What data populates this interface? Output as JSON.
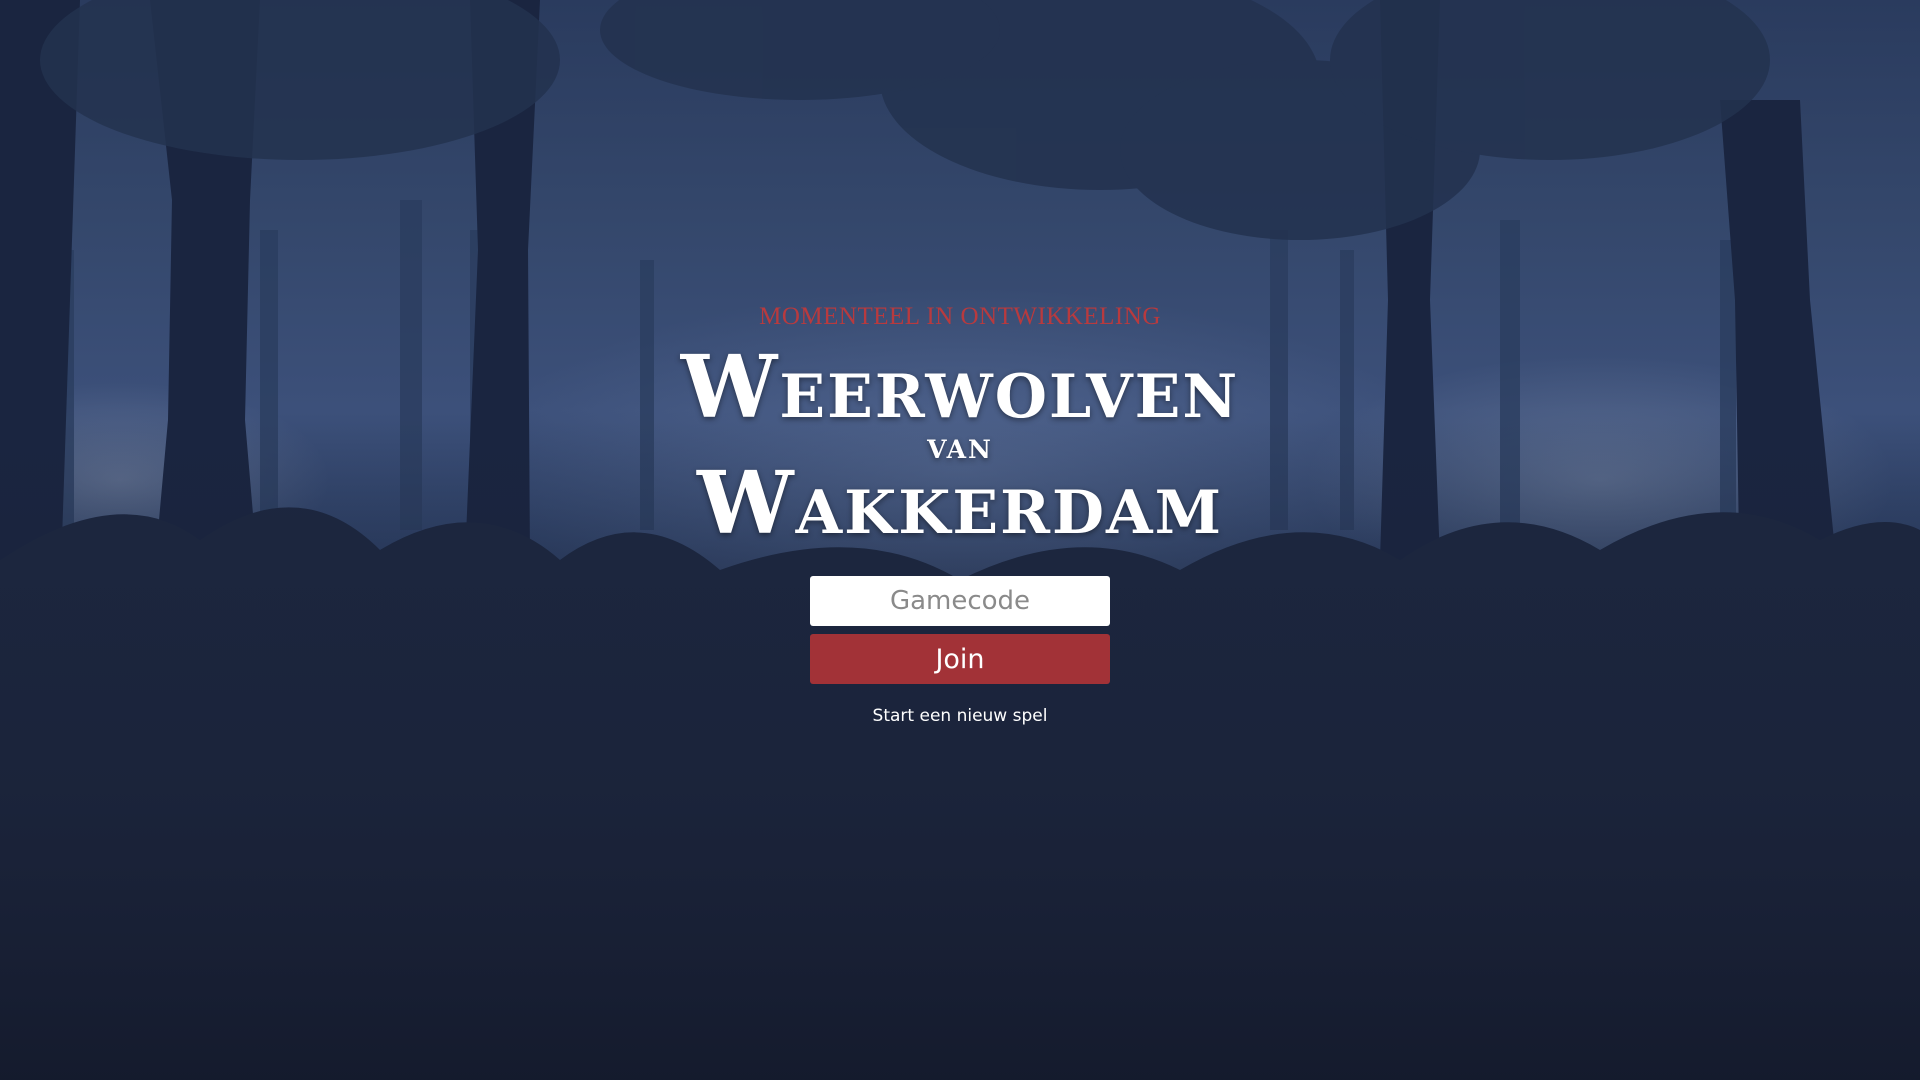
{
  "banner": {
    "status_text": "MOMENTEEL IN ONTWIKKELING"
  },
  "title": {
    "line1": "Weerwolven",
    "line2": "van",
    "line3": "Wakkerdam"
  },
  "join_form": {
    "gamecode_placeholder": "Gamecode",
    "gamecode_value": "",
    "join_label": "Join"
  },
  "links": {
    "new_game": "Start een nieuw spel"
  },
  "colors": {
    "accent_red": "#a23237",
    "status_red": "#b83a3e",
    "background_blue": "#2e4166"
  }
}
